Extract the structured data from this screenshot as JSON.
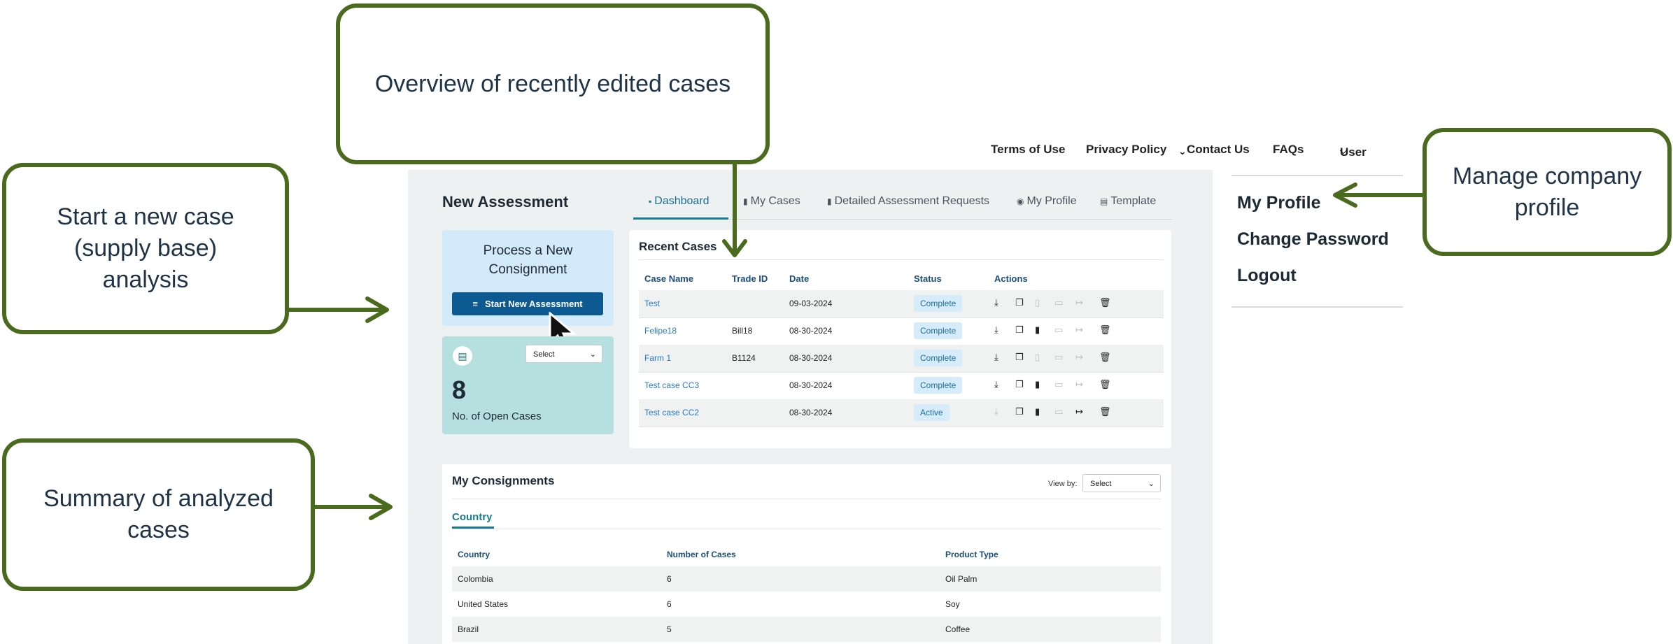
{
  "topnav": {
    "terms": "Terms of Use",
    "privacy": "Privacy Policy",
    "contact": "Contact Us",
    "faqs": "FAQs",
    "user": "User"
  },
  "app": {
    "title": "New Assessment",
    "tabs": [
      {
        "label": "Dashboard",
        "icon": "dashboard-icon"
      },
      {
        "label": "My Cases",
        "icon": "document-icon"
      },
      {
        "label": "Detailed Assessment Requests",
        "icon": "document-icon"
      },
      {
        "label": "My Profile",
        "icon": "user-icon"
      },
      {
        "label": "Template",
        "icon": "template-icon"
      }
    ]
  },
  "process_card": {
    "title_line1": "Process a New",
    "title_line2": "Consignment",
    "button": "Start New Assessment"
  },
  "open_cases": {
    "select": "Select",
    "count": "8",
    "label": "No. of Open Cases"
  },
  "recent_cases": {
    "title": "Recent Cases",
    "headers": [
      "Case Name",
      "Trade ID",
      "Date",
      "Status",
      "Actions"
    ],
    "rows": [
      {
        "name": "Test",
        "trade_id": "",
        "date": "09-03-2024",
        "status": "Complete"
      },
      {
        "name": "Felipe18",
        "trade_id": "Bill18",
        "date": "08-30-2024",
        "status": "Complete"
      },
      {
        "name": "Farm 1",
        "trade_id": "B1124",
        "date": "08-30-2024",
        "status": "Complete"
      },
      {
        "name": "Test case CC3",
        "trade_id": "",
        "date": "08-30-2024",
        "status": "Complete"
      },
      {
        "name": "Test case CC2",
        "trade_id": "",
        "date": "08-30-2024",
        "status": "Active"
      }
    ]
  },
  "consignments": {
    "title": "My Consignments",
    "view_by_label": "View by:",
    "view_by_value": "Select",
    "tab": "Country",
    "headers": [
      "Country",
      "Number of Cases",
      "Product Type"
    ],
    "rows": [
      {
        "country": "Colombia",
        "cases": "6",
        "product": "Oil Palm"
      },
      {
        "country": "United States",
        "cases": "6",
        "product": "Soy"
      },
      {
        "country": "Brazil",
        "cases": "5",
        "product": "Coffee"
      }
    ]
  },
  "user_menu": {
    "items": [
      "My Profile",
      "Change Password",
      "Logout"
    ]
  },
  "callouts": {
    "overview": "Overview of recently edited cases",
    "start_line1": "Start a new case",
    "start_line2": "(supply base)",
    "start_line3": "analysis",
    "manage_line1": "Manage company",
    "manage_line2": "profile",
    "summary_line1": "Summary of analyzed",
    "summary_line2": "cases"
  },
  "colors": {
    "callout_border": "#4a6a1e",
    "primary_button": "#0d5a93",
    "accent_teal": "#1b7c8f",
    "link_blue": "#2a78c7"
  }
}
